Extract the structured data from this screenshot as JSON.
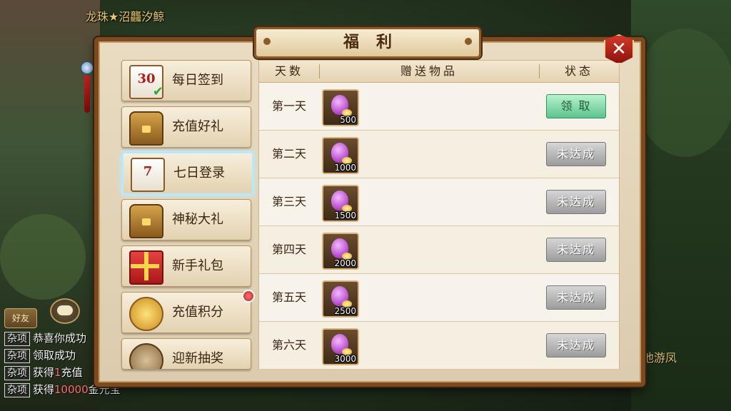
{
  "hud": {
    "top_name": "龙珠★沼龘汐鲸",
    "right_name": "池游凤",
    "friend_label": "好友"
  },
  "chat": [
    {
      "tag": "杂项",
      "text": "恭喜你成功"
    },
    {
      "tag": "杂项",
      "text": "领取成功"
    },
    {
      "tag": "杂项",
      "pre": "获得",
      "hl": "1",
      "post": "充值"
    },
    {
      "tag": "杂项",
      "pre": "获得",
      "hl": "10000",
      "post": "金元宝"
    }
  ],
  "panel": {
    "title": "福利",
    "close_label": "✕"
  },
  "menu": [
    {
      "label": "每日签到",
      "icon": "calendar-30-icon",
      "icon_text": "30"
    },
    {
      "label": "充值好礼",
      "icon": "treasure-chest-icon"
    },
    {
      "label": "七日登录",
      "icon": "calendar-7-icon",
      "icon_text": "7",
      "active": true
    },
    {
      "label": "神秘大礼",
      "icon": "gold-chest-icon"
    },
    {
      "label": "新手礼包",
      "icon": "gift-box-icon"
    },
    {
      "label": "充值积分",
      "icon": "gold-ingots-icon",
      "badge": true
    },
    {
      "label": "迎新抽奖",
      "icon": "lottery-wheel-icon"
    }
  ],
  "table": {
    "headers": {
      "day": "天数",
      "items": "赠送物品",
      "status": "状态"
    },
    "rows": [
      {
        "day": "第一天",
        "qty": "500",
        "status": "领 取",
        "state": "claimable"
      },
      {
        "day": "第二天",
        "qty": "1000",
        "status": "未达成",
        "state": "locked"
      },
      {
        "day": "第三天",
        "qty": "1500",
        "status": "未达成",
        "state": "locked"
      },
      {
        "day": "第四天",
        "qty": "2000",
        "status": "未达成",
        "state": "locked"
      },
      {
        "day": "第五天",
        "qty": "2500",
        "status": "未达成",
        "state": "locked"
      },
      {
        "day": "第六天",
        "qty": "3000",
        "status": "未达成",
        "state": "locked"
      }
    ]
  }
}
